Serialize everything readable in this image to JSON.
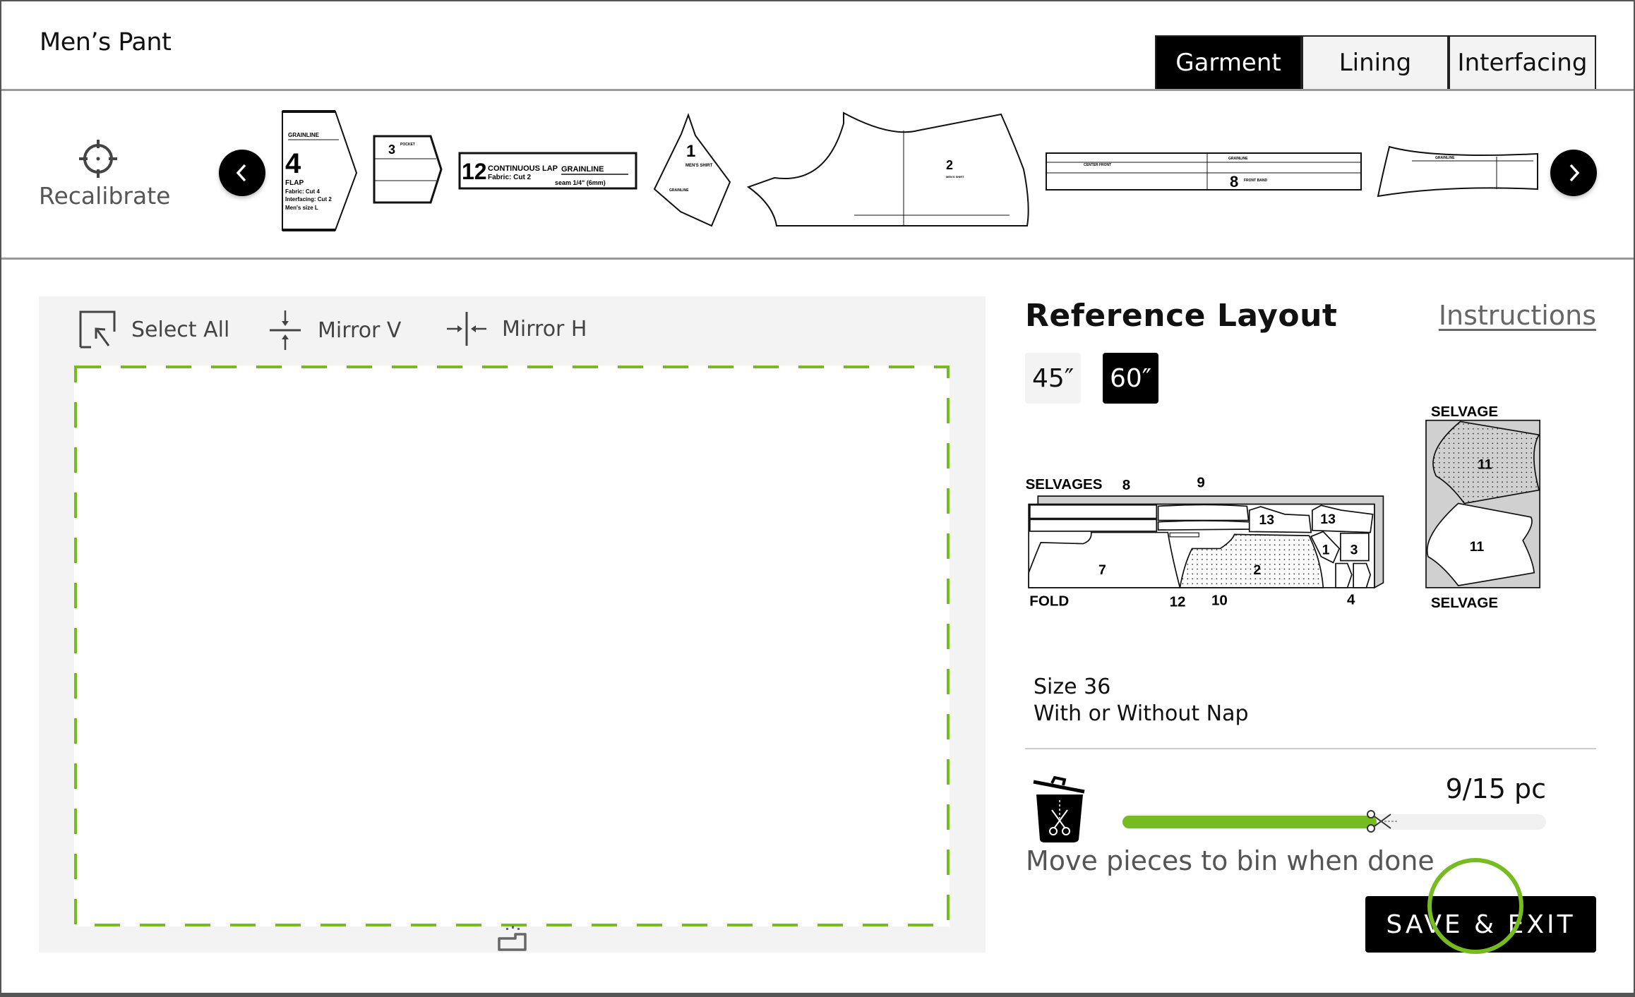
{
  "header": {
    "title": "Men’s Pant",
    "tabs": [
      {
        "label": "Garment",
        "active": true
      },
      {
        "label": "Lining",
        "active": false
      },
      {
        "label": "Interfacing",
        "active": false
      }
    ]
  },
  "pieces_bar": {
    "recalibrate_label": "Recalibrate",
    "icons": {
      "recalibrate": "crosshair-icon",
      "prev": "chevron-left-icon",
      "next": "chevron-right-icon"
    },
    "pieces": [
      {
        "number": "4",
        "name": "FLAP",
        "grainline": "GRAINLINE",
        "line1": "Fabric: Cut 4",
        "line2": "Interfacing: Cut 2",
        "line3": "Men's size L"
      },
      {
        "number": "3",
        "name": "POCKET"
      },
      {
        "number": "12",
        "name": "CONTINUOUS LAP",
        "line1": "Fabric: Cut 2",
        "grainline": "GRAINLINE",
        "seam": "seam 1/4\" (6mm)"
      },
      {
        "number": "1",
        "name": "MEN'S SHIRT",
        "grainline": "GRAINLINE"
      },
      {
        "number": "2",
        "name": "MEN'S SHIRT"
      },
      {
        "number": "8",
        "name": "FRONT BAND",
        "line1": "CENTER FRONT",
        "grainline": "GRAINLINE"
      },
      {
        "number": "",
        "grainline": "GRAINLINE"
      }
    ]
  },
  "canvas": {
    "tools": [
      {
        "label": "Select All",
        "icon": "select-all-icon"
      },
      {
        "label": "Mirror V",
        "icon": "mirror-vertical-icon"
      },
      {
        "label": "Mirror H",
        "icon": "mirror-horizontal-icon"
      }
    ],
    "work_area_border_color": "#76bc21",
    "bottom_icon": "tray-icon"
  },
  "reference": {
    "title": "Reference Layout",
    "instructions_link": "Instructions",
    "widths": [
      {
        "label": "45″",
        "active": false
      },
      {
        "label": "60″",
        "active": true
      }
    ],
    "diagram": {
      "selvages_label": "SELVAGES",
      "fold_label": "FOLD",
      "selvage_top": "SELVAGE",
      "selvage_bottom": "SELVAGE",
      "top_numbers": [
        "8",
        "9"
      ],
      "bottom_numbers": [
        "12",
        "10",
        "4"
      ],
      "piece_labels": [
        "13",
        "13",
        "7",
        "2",
        "1",
        "3",
        "11",
        "11"
      ]
    },
    "size": "Size 36",
    "nap": "With or Without Nap"
  },
  "progress": {
    "count": "9/15 pc",
    "fraction": 0.6,
    "hint": "Move pieces to bin when done",
    "bin_icon": "trash-bin-scissors-icon",
    "fill_color": "#76bc21"
  },
  "actions": {
    "save_exit": "SAVE & EXIT"
  }
}
